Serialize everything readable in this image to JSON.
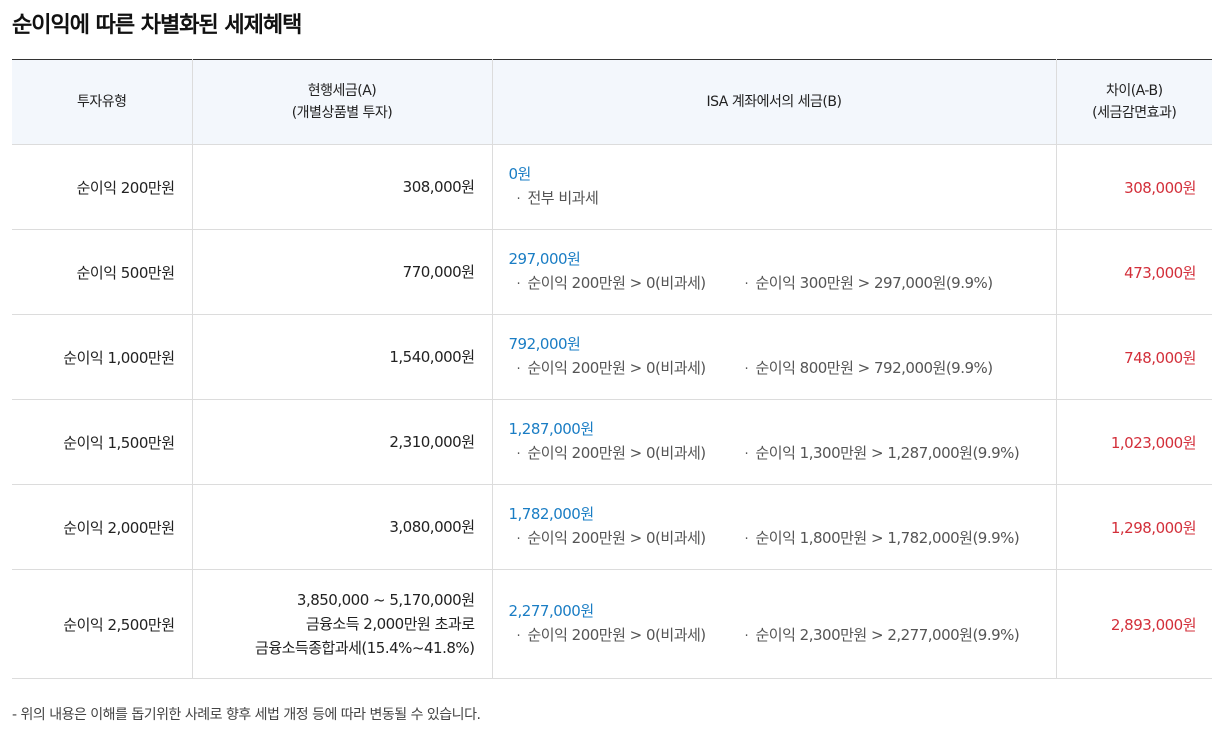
{
  "title": "순이익에 따른 차별화된 세제혜택",
  "bullet_glyph": "·",
  "headers": {
    "type": "투자유형",
    "current_line1": "현행세금(A)",
    "current_line2": "(개별상품별 투자)",
    "isa": "ISA 계좌에서의 세금(B)",
    "diff_line1": "차이(A-B)",
    "diff_line2": "(세금감면효과)"
  },
  "rows": [
    {
      "type": "순이익 200만원",
      "current": [
        "308,000원"
      ],
      "isa_amount": "0원",
      "isa_notes": [
        "전부 비과세"
      ],
      "diff": "308,000원"
    },
    {
      "type": "순이익 500만원",
      "current": [
        "770,000원"
      ],
      "isa_amount": "297,000원",
      "isa_notes": [
        "순이익 200만원 > 0(비과세)",
        "순이익 300만원 > 297,000원(9.9%)"
      ],
      "diff": "473,000원"
    },
    {
      "type": "순이익 1,000만원",
      "current": [
        "1,540,000원"
      ],
      "isa_amount": "792,000원",
      "isa_notes": [
        "순이익 200만원 > 0(비과세)",
        "순이익 800만원 > 792,000원(9.9%)"
      ],
      "diff": "748,000원"
    },
    {
      "type": "순이익 1,500만원",
      "current": [
        "2,310,000원"
      ],
      "isa_amount": "1,287,000원",
      "isa_notes": [
        "순이익 200만원 > 0(비과세)",
        "순이익 1,300만원 > 1,287,000원(9.9%)"
      ],
      "diff": "1,023,000원"
    },
    {
      "type": "순이익 2,000만원",
      "current": [
        "3,080,000원"
      ],
      "isa_amount": "1,782,000원",
      "isa_notes": [
        "순이익 200만원 > 0(비과세)",
        "순이익 1,800만원 > 1,782,000원(9.9%)"
      ],
      "diff": "1,298,000원"
    },
    {
      "type": "순이익 2,500만원",
      "current": [
        "3,850,000 ~ 5,170,000원",
        "금융소득 2,000만원 초과로",
        "금융소득종합과세(15.4%~41.8%)"
      ],
      "isa_amount": "2,277,000원",
      "isa_notes": [
        "순이익 200만원 > 0(비과세)",
        "순이익 2,300만원 > 2,277,000원(9.9%)"
      ],
      "diff": "2,893,000원"
    }
  ],
  "footnote": "- 위의 내용은 이해를 돕기위한 사례로 향후 세법 개정 등에 따라 변동될 수 있습니다.",
  "colors": {
    "isa_amount": "#1a7dc4",
    "diff": "#d32f3a",
    "header_bg": "#f3f7fc"
  }
}
